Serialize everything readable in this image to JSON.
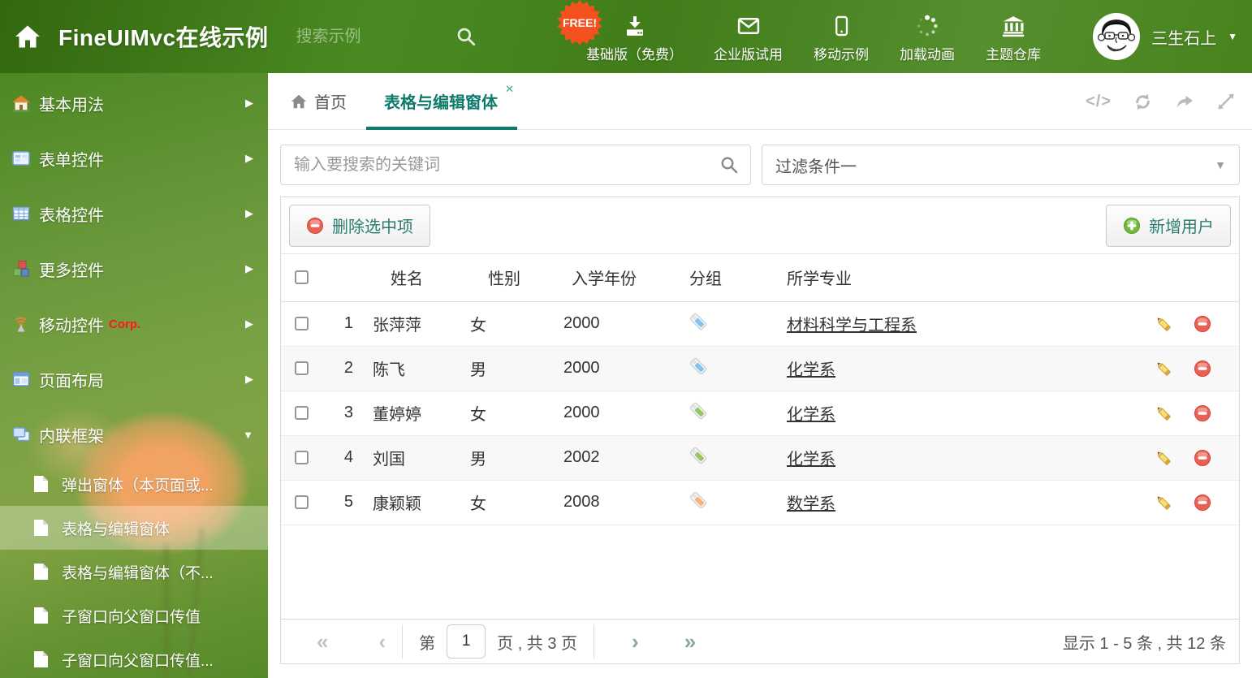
{
  "header": {
    "title": "FineUIMvc在线示例",
    "search_placeholder": "搜索示例",
    "free_badge": "FREE!",
    "nav": [
      {
        "label": "基础版（免费）"
      },
      {
        "label": "企业版试用"
      },
      {
        "label": "移动示例"
      },
      {
        "label": "加载动画"
      },
      {
        "label": "主题仓库"
      }
    ],
    "user_name": "三生石上"
  },
  "sidebar": {
    "items": [
      {
        "label": "基本用法"
      },
      {
        "label": "表单控件"
      },
      {
        "label": "表格控件"
      },
      {
        "label": "更多控件"
      },
      {
        "label": "移动控件",
        "badge": "Corp."
      },
      {
        "label": "页面布局"
      },
      {
        "label": "内联框架"
      }
    ],
    "subitems": [
      {
        "label": "弹出窗体（本页面或..."
      },
      {
        "label": "表格与编辑窗体"
      },
      {
        "label": "表格与编辑窗体（不..."
      },
      {
        "label": "子窗口向父窗口传值"
      },
      {
        "label": "子窗口向父窗口传值..."
      }
    ]
  },
  "tabs": {
    "home_label": "首页",
    "active_label": "表格与编辑窗体"
  },
  "filters": {
    "search_placeholder": "输入要搜索的关键词",
    "filter_selected": "过滤条件一"
  },
  "toolbar": {
    "delete_label": "删除选中项",
    "add_label": "新增用户"
  },
  "table": {
    "columns": {
      "name": "姓名",
      "gender": "性别",
      "year": "入学年份",
      "group": "分组",
      "major": "所学专业"
    },
    "rows": [
      {
        "num": "1",
        "name": "张萍萍",
        "gender": "女",
        "year": "2000",
        "tag_color": "#7fc4f0",
        "major": "材料科学与工程系"
      },
      {
        "num": "2",
        "name": "陈飞",
        "gender": "男",
        "year": "2000",
        "tag_color": "#7fc4f0",
        "major": "化学系"
      },
      {
        "num": "3",
        "name": "董婷婷",
        "gender": "女",
        "year": "2000",
        "tag_color": "#93c763",
        "major": "化学系"
      },
      {
        "num": "4",
        "name": "刘国",
        "gender": "男",
        "year": "2002",
        "tag_color": "#93c763",
        "major": "化学系"
      },
      {
        "num": "5",
        "name": "康颖颖",
        "gender": "女",
        "year": "2008",
        "tag_color": "#f6b26f",
        "major": "数学系"
      }
    ]
  },
  "pagination": {
    "page_prefix": "第",
    "page_value": "1",
    "page_suffix": "页 , 共 3 页",
    "summary": "显示 1 - 5 条 , 共 12 条"
  },
  "icons": {
    "tab_close": "✕",
    "caret_down": "▼",
    "item_arrow": "▶",
    "expanded_arrow": "▼",
    "pager_first": "«",
    "pager_prev": "‹",
    "pager_next": "›",
    "pager_last": "»",
    "code": "</>"
  },
  "colors": {
    "accent": "#0e7a6b",
    "free_badge": "#f4511e",
    "corp": "#ff1a0e",
    "tag_blue": "#7fc4f0",
    "tag_green": "#93c763",
    "tag_orange": "#f6b26f"
  }
}
